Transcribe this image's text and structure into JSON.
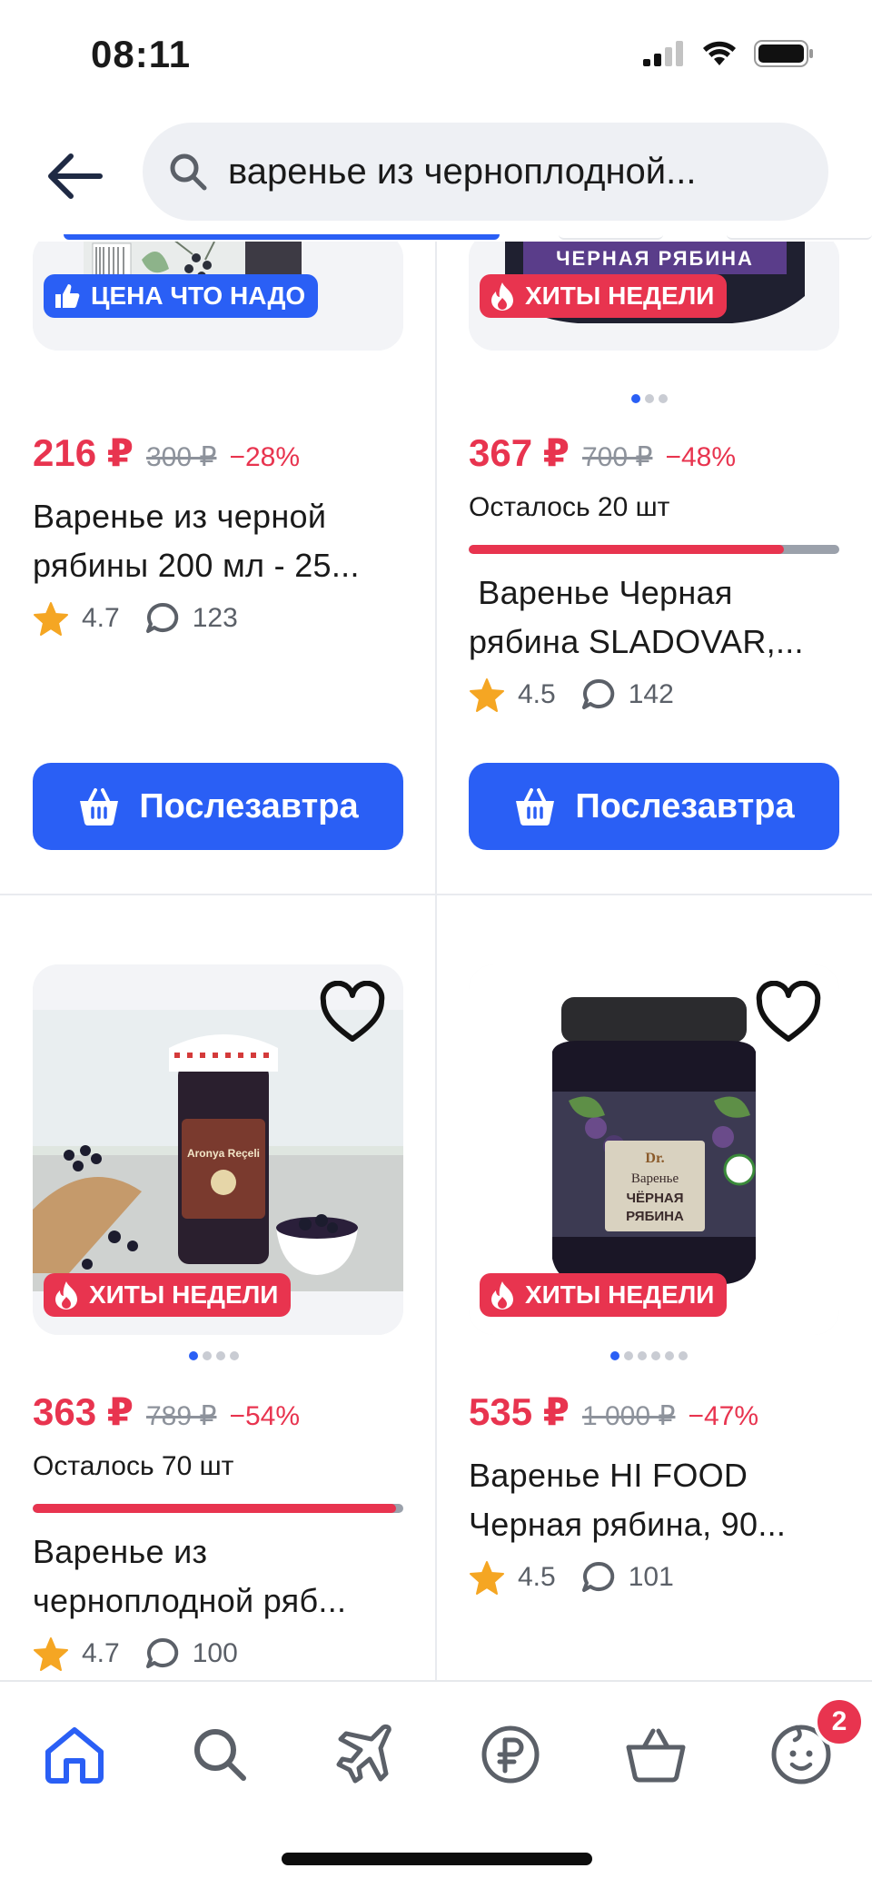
{
  "status_bar": {
    "time": "08:11"
  },
  "search": {
    "query": "варенье из черноплодной..."
  },
  "products": [
    {
      "badge": "ЦЕНА ЧТО НАДО",
      "price": "216 ₽",
      "old_price": "300 ₽",
      "discount": "−28%",
      "title_line1": "Варенье из черной",
      "title_line2": "рябины 200 мл - 25...",
      "rating": "4.7",
      "reviews": "123",
      "button": "Послезавтра"
    },
    {
      "badge": "ХИТЫ НЕДЕЛИ",
      "jar_label": "ЧЕРНАЯ РЯБИНА",
      "price": "367 ₽",
      "old_price": "700 ₽",
      "discount": "−48%",
      "stock": "Осталось 20 шт",
      "stock_level": 0.85,
      "title_line1": " Варенье Черная",
      "title_line2": "рябина SLADOVAR,...",
      "rating": "4.5",
      "reviews": "142",
      "button": "Послезавтра"
    },
    {
      "badge": "ХИТЫ НЕДЕЛИ",
      "jar_label": "Aronya Reçeli",
      "price": "363 ₽",
      "old_price": "789 ₽",
      "discount": "−54%",
      "stock": "Осталось 70 шт",
      "stock_level": 0.98,
      "title_line1": "Варенье из",
      "title_line2": "черноплодной ряб...",
      "rating": "4.7",
      "reviews": "100"
    },
    {
      "badge": "ХИТЫ НЕДЕЛИ",
      "jar_brand": "Dr.",
      "jar_label1": "Варенье",
      "jar_label2": "ЧЁРНАЯ",
      "jar_label3": "РЯБИНА",
      "price": "535 ₽",
      "old_price": "1 000 ₽",
      "discount": "−47%",
      "title_line1": "Варенье HI FOOD",
      "title_line2": "Черная рябина, 90...",
      "rating": "4.5",
      "reviews": "101"
    }
  ],
  "nav": {
    "items": [
      "home-icon",
      "search-icon",
      "plane-icon",
      "ruble-icon",
      "basket-icon",
      "profile-icon"
    ],
    "profile_badge": "2"
  },
  "colors": {
    "accent": "#2a5ff5",
    "price_red": "#e8344f"
  }
}
